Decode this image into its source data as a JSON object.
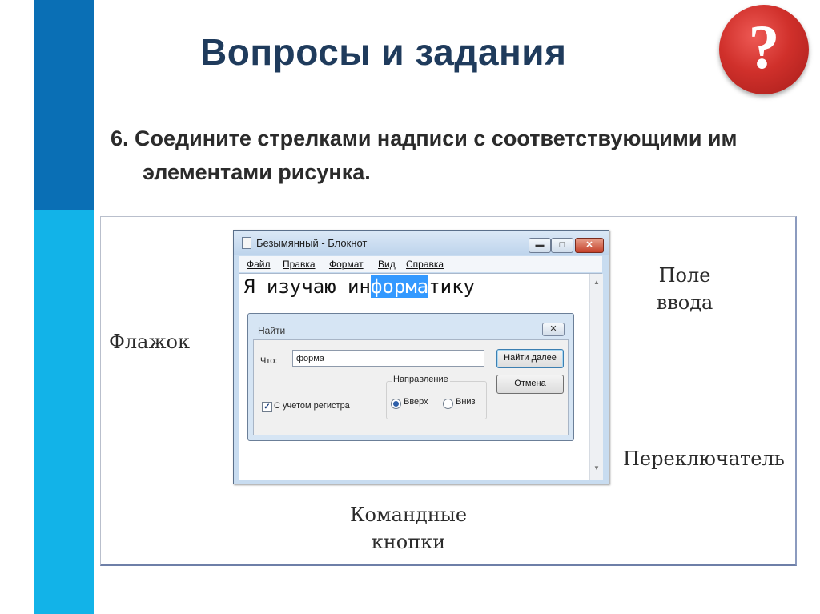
{
  "slide": {
    "title": "Вопросы и задания",
    "badge": "?",
    "task_line1": "6. Соедините стрелками надписи с соответствующими им",
    "task_line2": "элементами рисунка."
  },
  "labels": {
    "checkbox": "Флажок",
    "input_field_1": "Поле",
    "input_field_2": "ввода",
    "radio": "Переключатель",
    "buttons_1": "Командные",
    "buttons_2": "кнопки"
  },
  "notepad": {
    "title": "Безымянный - Блокнот",
    "menu": [
      "Файл",
      "Правка",
      "Формат",
      "Вид",
      "Справка"
    ],
    "text_before": "Я изучаю ин",
    "text_selected": "форма",
    "text_after": "тику",
    "min_glyph": "▬",
    "max_glyph": "□",
    "close_glyph": "✕"
  },
  "find_dialog": {
    "title": "Найти",
    "close_glyph": "✕",
    "what_label": "Что:",
    "what_value": "форма",
    "find_next": "Найти далее",
    "cancel": "Отмена",
    "direction_label": "Направление",
    "up_label": "Вверх",
    "down_label": "Вниз",
    "match_case_label": "С учетом регистра",
    "match_case_checked": true,
    "direction_selected": "Вверх"
  },
  "colors": {
    "bar_dark": "#0a6fb5",
    "bar_light": "#12b3e8",
    "badge": "#d0302b",
    "selection": "#3399ff"
  }
}
